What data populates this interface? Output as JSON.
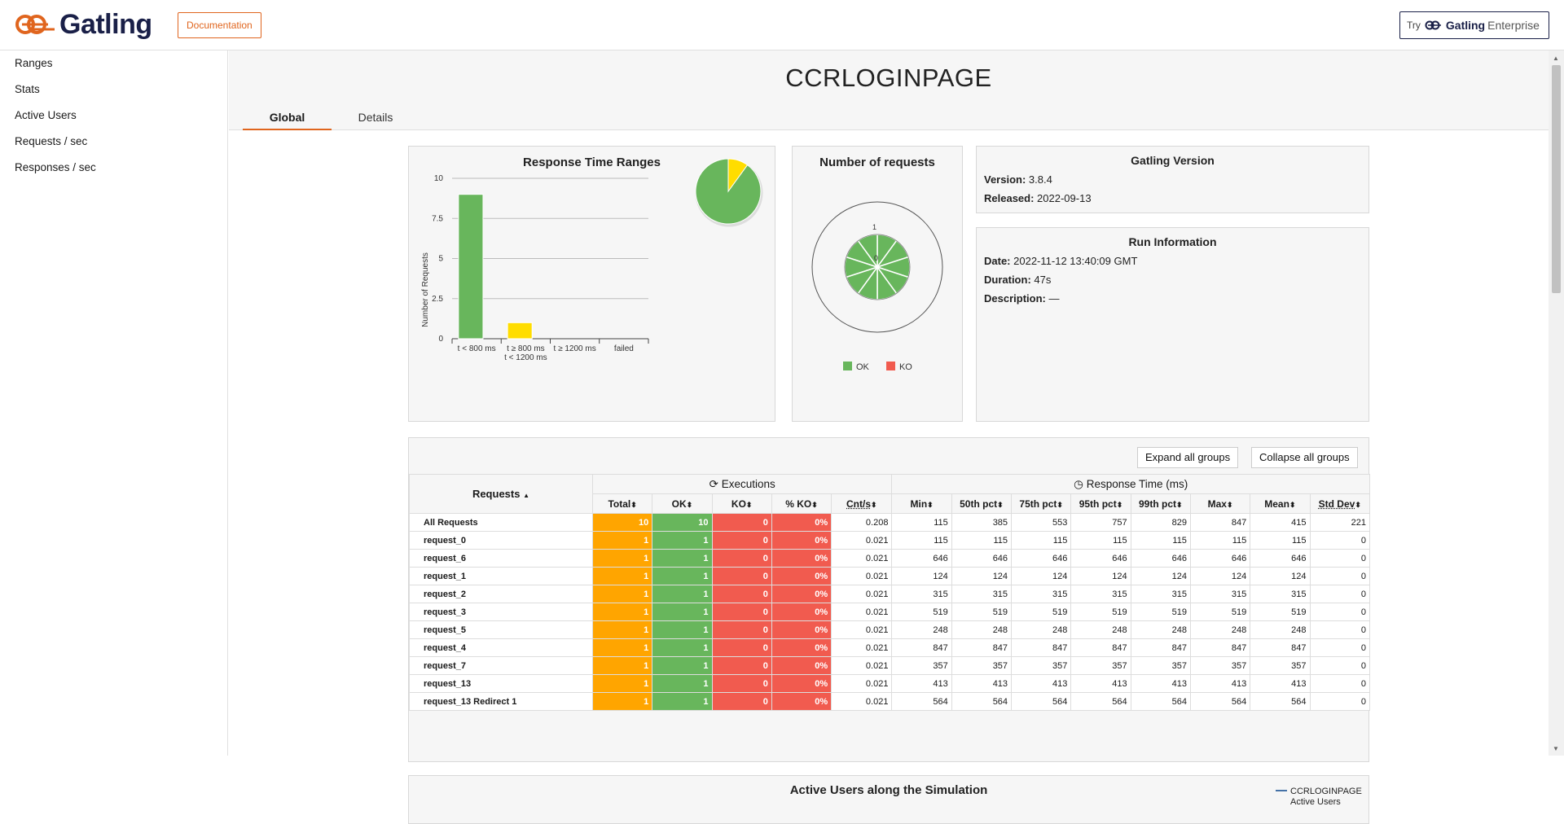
{
  "header": {
    "logo_text": "Gatling",
    "doc_button": "Documentation",
    "enterprise_try": "Try",
    "enterprise_gatling": "Gatling",
    "enterprise_suffix": "Enterprise"
  },
  "sidebar": {
    "items": [
      {
        "label": "Ranges"
      },
      {
        "label": "Stats"
      },
      {
        "label": "Active Users"
      },
      {
        "label": "Requests / sec"
      },
      {
        "label": "Responses / sec"
      }
    ]
  },
  "page": {
    "title": "CCRLOGINPAGE",
    "tabs": [
      {
        "label": "Global"
      },
      {
        "label": "Details"
      }
    ]
  },
  "ranges_panel": {
    "title": "Response Time Ranges",
    "ylabel": "Number of Requests"
  },
  "requests_panel": {
    "title": "Number of requests",
    "legend_ok": "OK",
    "legend_ko": "KO",
    "tick_outer": "1",
    "tick_center": "0"
  },
  "version_panel": {
    "title": "Gatling Version",
    "version_label": "Version:",
    "version_value": "3.8.4",
    "released_label": "Released:",
    "released_value": "2022-09-13"
  },
  "run_panel": {
    "title": "Run Information",
    "date_label": "Date:",
    "date_value": "2022-11-12 13:40:09 GMT",
    "duration_label": "Duration:",
    "duration_value": "47s",
    "description_label": "Description:",
    "description_value": "—"
  },
  "table": {
    "expand_button": "Expand all groups",
    "collapse_button": "Collapse all groups",
    "requests_header": "Requests",
    "executions_header": "Executions",
    "response_time_header": "Response Time (ms)",
    "columns": [
      "Total",
      "OK",
      "KO",
      "% KO",
      "Cnt/s",
      "Min",
      "50th pct",
      "75th pct",
      "95th pct",
      "99th pct",
      "Max",
      "Mean",
      "Std Dev"
    ],
    "rows": [
      {
        "name": "All Requests",
        "total": "10",
        "ok": "10",
        "ko": "0",
        "pct_ko": "0%",
        "cnt": "0.208",
        "min": "115",
        "p50": "385",
        "p75": "553",
        "p95": "757",
        "p99": "829",
        "max": "847",
        "mean": "415",
        "std": "221"
      },
      {
        "name": "request_0",
        "total": "1",
        "ok": "1",
        "ko": "0",
        "pct_ko": "0%",
        "cnt": "0.021",
        "min": "115",
        "p50": "115",
        "p75": "115",
        "p95": "115",
        "p99": "115",
        "max": "115",
        "mean": "115",
        "std": "0"
      },
      {
        "name": "request_6",
        "total": "1",
        "ok": "1",
        "ko": "0",
        "pct_ko": "0%",
        "cnt": "0.021",
        "min": "646",
        "p50": "646",
        "p75": "646",
        "p95": "646",
        "p99": "646",
        "max": "646",
        "mean": "646",
        "std": "0"
      },
      {
        "name": "request_1",
        "total": "1",
        "ok": "1",
        "ko": "0",
        "pct_ko": "0%",
        "cnt": "0.021",
        "min": "124",
        "p50": "124",
        "p75": "124",
        "p95": "124",
        "p99": "124",
        "max": "124",
        "mean": "124",
        "std": "0"
      },
      {
        "name": "request_2",
        "total": "1",
        "ok": "1",
        "ko": "0",
        "pct_ko": "0%",
        "cnt": "0.021",
        "min": "315",
        "p50": "315",
        "p75": "315",
        "p95": "315",
        "p99": "315",
        "max": "315",
        "mean": "315",
        "std": "0"
      },
      {
        "name": "request_3",
        "total": "1",
        "ok": "1",
        "ko": "0",
        "pct_ko": "0%",
        "cnt": "0.021",
        "min": "519",
        "p50": "519",
        "p75": "519",
        "p95": "519",
        "p99": "519",
        "max": "519",
        "mean": "519",
        "std": "0"
      },
      {
        "name": "request_5",
        "total": "1",
        "ok": "1",
        "ko": "0",
        "pct_ko": "0%",
        "cnt": "0.021",
        "min": "248",
        "p50": "248",
        "p75": "248",
        "p95": "248",
        "p99": "248",
        "max": "248",
        "mean": "248",
        "std": "0"
      },
      {
        "name": "request_4",
        "total": "1",
        "ok": "1",
        "ko": "0",
        "pct_ko": "0%",
        "cnt": "0.021",
        "min": "847",
        "p50": "847",
        "p75": "847",
        "p95": "847",
        "p99": "847",
        "max": "847",
        "mean": "847",
        "std": "0"
      },
      {
        "name": "request_7",
        "total": "1",
        "ok": "1",
        "ko": "0",
        "pct_ko": "0%",
        "cnt": "0.021",
        "min": "357",
        "p50": "357",
        "p75": "357",
        "p95": "357",
        "p99": "357",
        "max": "357",
        "mean": "357",
        "std": "0"
      },
      {
        "name": "request_13",
        "total": "1",
        "ok": "1",
        "ko": "0",
        "pct_ko": "0%",
        "cnt": "0.021",
        "min": "413",
        "p50": "413",
        "p75": "413",
        "p95": "413",
        "p99": "413",
        "max": "413",
        "mean": "413",
        "std": "0"
      },
      {
        "name": "request_13 Redirect 1",
        "total": "1",
        "ok": "1",
        "ko": "0",
        "pct_ko": "0%",
        "cnt": "0.021",
        "min": "564",
        "p50": "564",
        "p75": "564",
        "p95": "564",
        "p99": "564",
        "max": "564",
        "mean": "564",
        "std": "0"
      }
    ]
  },
  "active_panel": {
    "title": "Active Users along the Simulation",
    "legend_series": "CCRLOGINPAGE",
    "legend_sub": "Active Users"
  },
  "colors": {
    "brand_orange": "#e0651e",
    "brand_navy": "#1a2048",
    "ok_green": "#68b65c",
    "ko_red": "#f15b4f",
    "total_orange": "#ffa500",
    "range_yellow": "#ffdd00"
  },
  "chart_data": [
    {
      "type": "bar",
      "title": "Response Time Ranges",
      "ylabel": "Number of Requests",
      "categories": [
        "t < 800 ms",
        "t ≥ 800 ms\nt < 1200 ms",
        "t ≥ 1200 ms",
        "failed"
      ],
      "values": [
        9,
        1,
        0,
        0
      ],
      "bar_colors": [
        "#68b65c",
        "#ffdd00",
        "#f15b4f",
        "#f15b4f"
      ],
      "y_ticks": [
        "0",
        "2.5",
        "5",
        "7.5",
        "10"
      ],
      "ylim": [
        0,
        10
      ],
      "inset_pie": {
        "values": [
          9,
          1
        ],
        "colors": [
          "#68b65c",
          "#ffdd00"
        ]
      }
    },
    {
      "type": "pie",
      "title": "Number of requests",
      "categories": [
        "OK",
        "KO"
      ],
      "values": [
        10,
        0
      ],
      "colors": [
        "#68b65c",
        "#f15b4f"
      ]
    }
  ]
}
